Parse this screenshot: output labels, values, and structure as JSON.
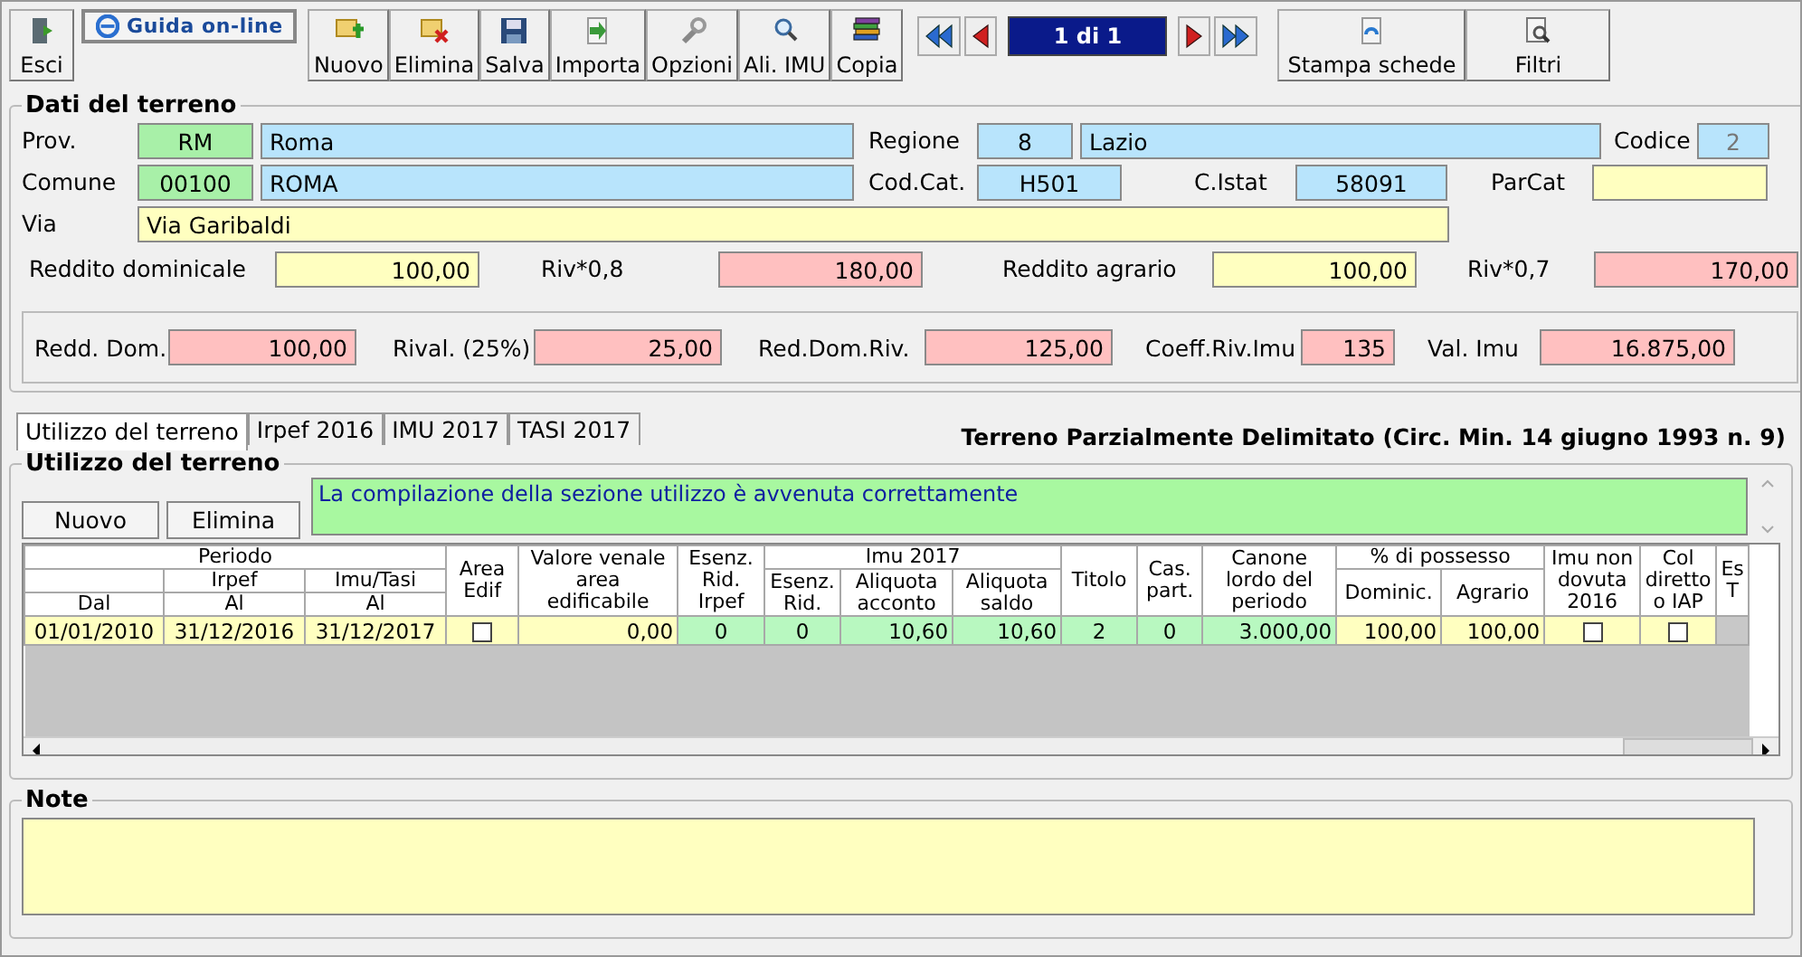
{
  "toolbar": {
    "exit_button": {
      "label": "Esci"
    },
    "help_button": {
      "label": "Guida on-line"
    },
    "buttons": [
      {
        "kind": "new",
        "label": "Nuovo"
      },
      {
        "kind": "delete",
        "label": "Elimina"
      },
      {
        "kind": "save",
        "label": "Salva"
      },
      {
        "kind": "import",
        "label": "Importa"
      },
      {
        "kind": "options",
        "label": "Opzioni"
      },
      {
        "kind": "rates",
        "label": "Ali. IMU"
      },
      {
        "kind": "copy",
        "label": "Copia"
      }
    ],
    "navigator": {
      "counter": "1 di 1"
    },
    "print_button": {
      "label": "Stampa schede"
    },
    "filter_button": {
      "label": "Filtri"
    }
  },
  "land_section": {
    "title": "Dati del terreno",
    "province": {
      "label": "Prov.",
      "code": "RM",
      "name": "Roma"
    },
    "region": {
      "label": "Regione",
      "code": "8",
      "name": "Lazio"
    },
    "code": {
      "label": "Codice",
      "value": "2"
    },
    "municipality": {
      "label": "Comune",
      "code": "00100",
      "name": "ROMA"
    },
    "cadastral_code": {
      "label": "Cod.Cat.",
      "value": "H501"
    },
    "istat": {
      "label": "C.Istat",
      "value": "58091"
    },
    "parcat": {
      "label": "ParCat"
    },
    "street": {
      "label": "Via",
      "value": "Via Garibaldi"
    },
    "income": [
      {
        "label": "Reddito dominicale",
        "value": "100,00",
        "kind": "input"
      },
      {
        "label": "Riv*0,8",
        "value": "180,00",
        "kind": "computed"
      },
      {
        "label": "Reddito agrario",
        "value": "100,00",
        "kind": "input"
      },
      {
        "label": "Riv*0,7",
        "value": "170,00",
        "kind": "computed"
      }
    ],
    "revaluation": [
      {
        "label": "Redd. Dom.",
        "value": "100,00"
      },
      {
        "label": "Rival. (25%)",
        "value": "25,00"
      },
      {
        "label": "Red.Dom.Riv.",
        "value": "125,00"
      },
      {
        "label": "Coeff.Riv.Imu",
        "value": "135"
      },
      {
        "label": "Val. Imu",
        "value": "16.875,00"
      }
    ]
  },
  "tabs": [
    {
      "label": "Utilizzo del terreno",
      "selected": true
    },
    {
      "label": "Irpef 2016",
      "selected": false
    },
    {
      "label": "IMU 2017",
      "selected": false
    },
    {
      "label": "TASI 2017",
      "selected": false
    }
  ],
  "tabs_caption": "Terreno Parzialmente Delimitato (Circ. Min. 14 giugno 1993 n. 9)",
  "usage_section": {
    "title": "Utilizzo del terreno",
    "buttons": [
      "Nuovo",
      "Elimina"
    ],
    "message": "La compilazione della sezione utilizzo è avvenuta correttamente"
  },
  "table": {
    "header_rows": [
      [
        {
          "text": "Periodo",
          "colspan": 3
        },
        {
          "text": "Area\nEdif",
          "rowspan": 3
        },
        {
          "text": "Valore venale\narea\nedificabile",
          "rowspan": 3
        },
        {
          "text": "Esenz.\nRid.\nIrpef",
          "rowspan": 3
        },
        {
          "text": "Imu 2017",
          "colspan": 3
        },
        {
          "text": "Titolo",
          "rowspan": 3
        },
        {
          "text": "Cas.\npart.",
          "rowspan": 3
        },
        {
          "text": "Canone\nlordo del\nperiodo",
          "rowspan": 3
        },
        {
          "text": "% di possesso",
          "colspan": 2
        },
        {
          "text": "Imu non\ndovuta\n2016",
          "rowspan": 3
        },
        {
          "text": "Col\ndiretto\no IAP",
          "rowspan": 3
        },
        {
          "text": "Es\nT",
          "rowspan": 3
        }
      ],
      [
        {},
        {
          "text": "Irpef"
        },
        {
          "text": "Imu/Tasi"
        },
        {
          "text": "Esenz.\nRid.",
          "rowspan": 2
        },
        {
          "text": "Aliquota\nacconto",
          "rowspan": 2
        },
        {
          "text": "Aliquota\nsaldo",
          "rowspan": 2
        },
        {
          "text": "Dominic.",
          "rowspan": 2
        },
        {
          "text": "Agrario",
          "rowspan": 2
        }
      ],
      [
        {
          "text": "Dal"
        },
        {
          "text": "Al"
        },
        {
          "text": "Al"
        }
      ]
    ],
    "rows": [
      [
        {
          "kind": "date",
          "value": "01/01/2010"
        },
        {
          "kind": "date",
          "value": "31/12/2016"
        },
        {
          "kind": "date",
          "value": "31/12/2017"
        },
        {
          "kind": "checkbox",
          "checked": false
        },
        {
          "kind": "amount",
          "value": "0,00"
        },
        {
          "kind": "flag",
          "value": "0"
        },
        {
          "kind": "flag",
          "value": "0"
        },
        {
          "kind": "rate",
          "value": "10,60"
        },
        {
          "kind": "rate",
          "value": "10,60"
        },
        {
          "kind": "flag",
          "value": "2"
        },
        {
          "kind": "flag",
          "value": "0"
        },
        {
          "kind": "rate",
          "value": "3.000,00"
        },
        {
          "kind": "amount",
          "value": "100,00"
        },
        {
          "kind": "amount",
          "value": "100,00"
        },
        {
          "kind": "checkbox",
          "checked": false
        },
        {
          "kind": "checkbox",
          "checked": false
        }
      ]
    ]
  },
  "note_section": {
    "title": "Note"
  }
}
